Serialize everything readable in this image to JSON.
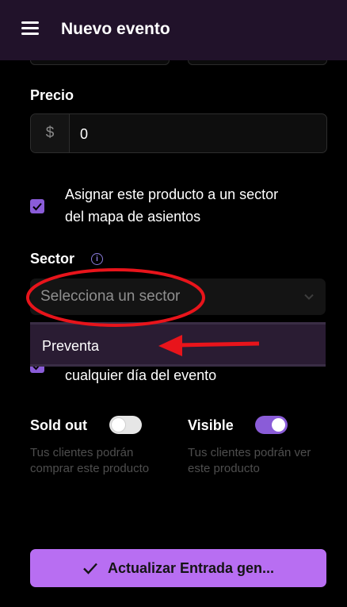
{
  "header": {
    "title": "Nuevo evento",
    "menu_icon": "hamburger-menu-icon",
    "background": "#21122a"
  },
  "price": {
    "label": "Precio",
    "prefix": "$",
    "value": "0"
  },
  "assign_sector": {
    "checked": true,
    "text_line1": "Asignar este producto a un sector",
    "text_line2": "del mapa de asientos"
  },
  "sector": {
    "label": "Sector",
    "info_icon": "info-icon",
    "placeholder": "Selecciona un sector",
    "options": [
      "Preventa"
    ]
  },
  "any_day": {
    "checked": true,
    "text": "cualquier día del evento"
  },
  "sold_out": {
    "label": "Sold out",
    "on": false,
    "helper": "Tus clientes podrán comprar este producto"
  },
  "visible": {
    "label": "Visible",
    "on": true,
    "helper": "Tus clientes podrán ver este producto"
  },
  "submit": {
    "label": "Actualizar Entrada gen...",
    "icon": "check-icon"
  },
  "colors": {
    "accent": "#8a5cd8",
    "button": "#b86ef2",
    "annotation": "#e8141b"
  }
}
